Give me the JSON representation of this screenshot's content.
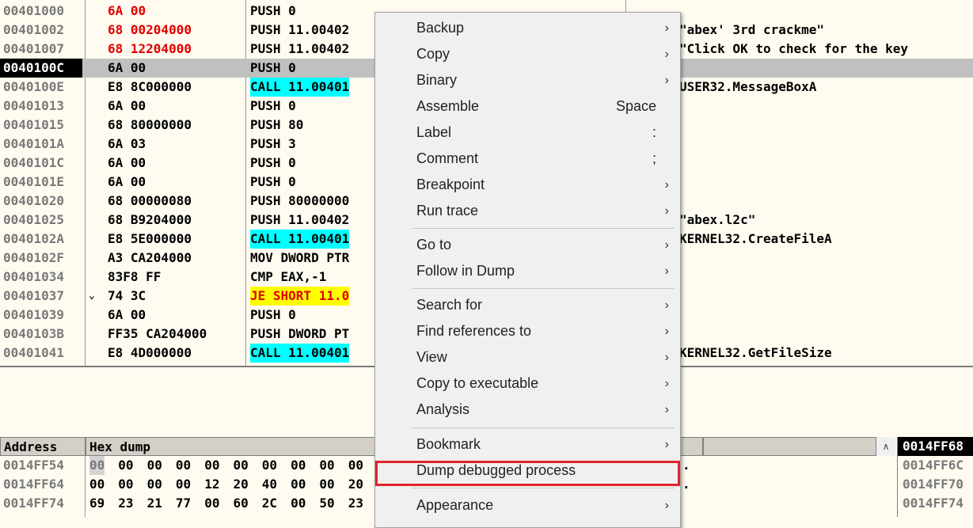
{
  "disasm": {
    "rows": [
      {
        "addr": "00401000",
        "hex": "6A 00",
        "hex_red": true,
        "dis": "PUSH 0",
        "dis_style": "",
        "cmt": "",
        "jmp": ""
      },
      {
        "addr": "00401002",
        "hex": "68 00204000",
        "hex_red": true,
        "dis": "PUSH 11.00402",
        "dis_style": "",
        "cmt": "\"abex' 3rd crackme\"",
        "jmp": ""
      },
      {
        "addr": "00401007",
        "hex": "68 12204000",
        "hex_red": true,
        "dis": "PUSH 11.00402",
        "dis_style": "",
        "cmt": "\"Click OK to check for the key",
        "jmp": ""
      },
      {
        "addr": "0040100C",
        "hex": "6A 00",
        "hex_red": false,
        "dis": "PUSH 0",
        "dis_style": "",
        "cmt": "",
        "jmp": "",
        "selected": true
      },
      {
        "addr": "0040100E",
        "hex": "E8 8C000000",
        "hex_red": false,
        "dis": "CALL 11.00401",
        "dis_style": "call",
        "cmt": "USER32.MessageBoxA",
        "jmp": ""
      },
      {
        "addr": "00401013",
        "hex": "6A 00",
        "hex_red": false,
        "dis": "PUSH 0",
        "dis_style": "",
        "cmt": "",
        "jmp": ""
      },
      {
        "addr": "00401015",
        "hex": "68 80000000",
        "hex_red": false,
        "dis": "PUSH 80",
        "dis_style": "",
        "cmt": "",
        "jmp": ""
      },
      {
        "addr": "0040101A",
        "hex": "6A 03",
        "hex_red": false,
        "dis": "PUSH 3",
        "dis_style": "",
        "cmt": "",
        "jmp": ""
      },
      {
        "addr": "0040101C",
        "hex": "6A 00",
        "hex_red": false,
        "dis": "PUSH 0",
        "dis_style": "",
        "cmt": "",
        "jmp": ""
      },
      {
        "addr": "0040101E",
        "hex": "6A 00",
        "hex_red": false,
        "dis": "PUSH 0",
        "dis_style": "",
        "cmt": "",
        "jmp": ""
      },
      {
        "addr": "00401020",
        "hex": "68 00000080",
        "hex_red": false,
        "dis": "PUSH 80000000",
        "dis_style": "",
        "cmt": "",
        "jmp": ""
      },
      {
        "addr": "00401025",
        "hex": "68 B9204000",
        "hex_red": false,
        "dis": "PUSH 11.00402",
        "dis_style": "",
        "cmt": "\"abex.l2c\"",
        "jmp": ""
      },
      {
        "addr": "0040102A",
        "hex": "E8 5E000000",
        "hex_red": false,
        "dis": "CALL 11.00401",
        "dis_style": "call",
        "cmt": "KERNEL32.CreateFileA",
        "jmp": ""
      },
      {
        "addr": "0040102F",
        "hex": "A3 CA204000",
        "hex_red": false,
        "dis": "MOV DWORD PTR",
        "dis_style": "",
        "cmt": "",
        "jmp": ""
      },
      {
        "addr": "00401034",
        "hex": "83F8 FF",
        "hex_red": false,
        "dis": "CMP EAX,-1",
        "dis_style": "",
        "cmt": "",
        "jmp": ""
      },
      {
        "addr": "00401037",
        "hex": "74 3C",
        "hex_red": false,
        "dis": "JE SHORT 11.0",
        "dis_style": "jmp",
        "cmt": "",
        "jmp": "⌄"
      },
      {
        "addr": "00401039",
        "hex": "6A 00",
        "hex_red": false,
        "dis": "PUSH 0",
        "dis_style": "",
        "cmt": "",
        "jmp": ""
      },
      {
        "addr": "0040103B",
        "hex": "FF35 CA204000",
        "hex_red": false,
        "dis": "PUSH DWORD PT",
        "dis_style": "",
        "cmt": "",
        "jmp": ""
      },
      {
        "addr": "00401041",
        "hex": "E8 4D000000",
        "hex_red": false,
        "dis": "CALL 11.00401",
        "dis_style": "call",
        "cmt": "KERNEL32.GetFileSize",
        "jmp": ""
      }
    ]
  },
  "dump": {
    "headers": {
      "address": "Address",
      "hex": "Hex dump"
    },
    "rows": [
      {
        "addr": "0014FF54",
        "bytes": [
          "00",
          "00",
          "00",
          "00",
          "00",
          "00",
          "00",
          "00",
          "00",
          "00"
        ],
        "tail": "."
      },
      {
        "addr": "0014FF64",
        "bytes": [
          "00",
          "00",
          "00",
          "00",
          "12",
          "20",
          "40",
          "00",
          "00",
          "20"
        ],
        "tail": "."
      },
      {
        "addr": "0014FF74",
        "bytes": [
          "69",
          "23",
          "21",
          "77",
          "00",
          "60",
          "2C",
          "00",
          "50",
          "23"
        ],
        "tail": ""
      }
    ]
  },
  "stack": {
    "top": "0014FF68",
    "rows": [
      "0014FF6C",
      "0014FF70",
      "0014FF74"
    ]
  },
  "menu": {
    "items": [
      {
        "label": "Backup",
        "shortcut": "",
        "arrow": true
      },
      {
        "label": "Copy",
        "shortcut": "",
        "arrow": true
      },
      {
        "label": "Binary",
        "shortcut": "",
        "arrow": true
      },
      {
        "label": "Assemble",
        "shortcut": "Space",
        "arrow": false
      },
      {
        "label": "Label",
        "shortcut": ":",
        "arrow": false
      },
      {
        "label": "Comment",
        "shortcut": ";",
        "arrow": false
      },
      {
        "label": "Breakpoint",
        "shortcut": "",
        "arrow": true
      },
      {
        "label": "Run trace",
        "shortcut": "",
        "arrow": true
      },
      {
        "label": "Go to",
        "shortcut": "",
        "arrow": true
      },
      {
        "label": "Follow in Dump",
        "shortcut": "",
        "arrow": true
      },
      {
        "label": "Search for",
        "shortcut": "",
        "arrow": true
      },
      {
        "label": "Find references to",
        "shortcut": "",
        "arrow": true
      },
      {
        "label": "View",
        "shortcut": "",
        "arrow": true
      },
      {
        "label": "Copy to executable",
        "shortcut": "",
        "arrow": true
      },
      {
        "label": "Analysis",
        "shortcut": "",
        "arrow": true
      },
      {
        "label": "Bookmark",
        "shortcut": "",
        "arrow": true
      },
      {
        "label": "Dump debugged process",
        "shortcut": "",
        "arrow": false
      },
      {
        "label": "Appearance",
        "shortcut": "",
        "arrow": true
      }
    ],
    "highlight_color": "#e0232b"
  },
  "colors": {
    "call_bg": "#00ffff",
    "jmp_bg": "#ffff00",
    "red_text": "#e00000",
    "selected_addr_bg": "#000000"
  }
}
